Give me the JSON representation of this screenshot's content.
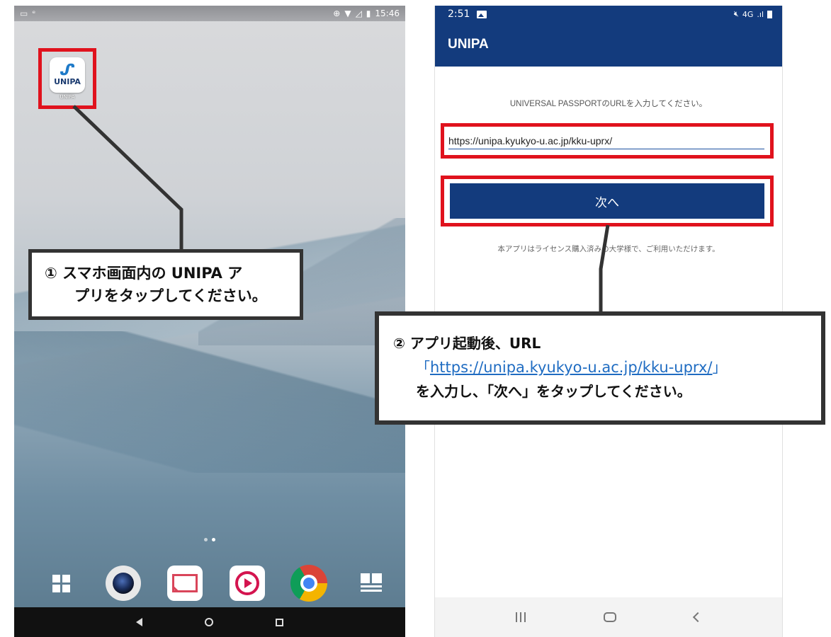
{
  "left_phone": {
    "status_time": "15:46",
    "app_icon": {
      "logo_text": "UNIPA",
      "label": "UNIPA"
    },
    "callout": {
      "line1": "① スマホ画面内の UNIPA ア",
      "line2": "プリをタップしてください。"
    },
    "dock_apps": [
      "apps-grid-icon",
      "camera-icon",
      "mail-icon",
      "video-play-icon",
      "chrome-icon",
      "news-icon"
    ]
  },
  "right_phone": {
    "status_time": "2:51",
    "status_network": "4G",
    "app_title": "UNIPA",
    "instruction": "UNIVERSAL PASSPORTのURLを入力してください。",
    "url_value": "https://unipa.kyukyo-u.ac.jp/kku-uprx/",
    "next_button": "次へ",
    "license_note": "本アプリはライセンス購入済みの大学様で、ご利用いただけます。"
  },
  "callout2": {
    "line1": "② アプリ起動後、URL",
    "open_bracket": "「",
    "url": "https://unipa.kyukyo-u.ac.jp/kku-uprx/",
    "close_bracket": "」",
    "line3": "を入力し、「次へ」をタップしてください。"
  },
  "colors": {
    "highlight_red": "#e0121d",
    "brand_navy": "#133b7d",
    "link_blue": "#1f6cc2",
    "callout_border": "#333333"
  }
}
